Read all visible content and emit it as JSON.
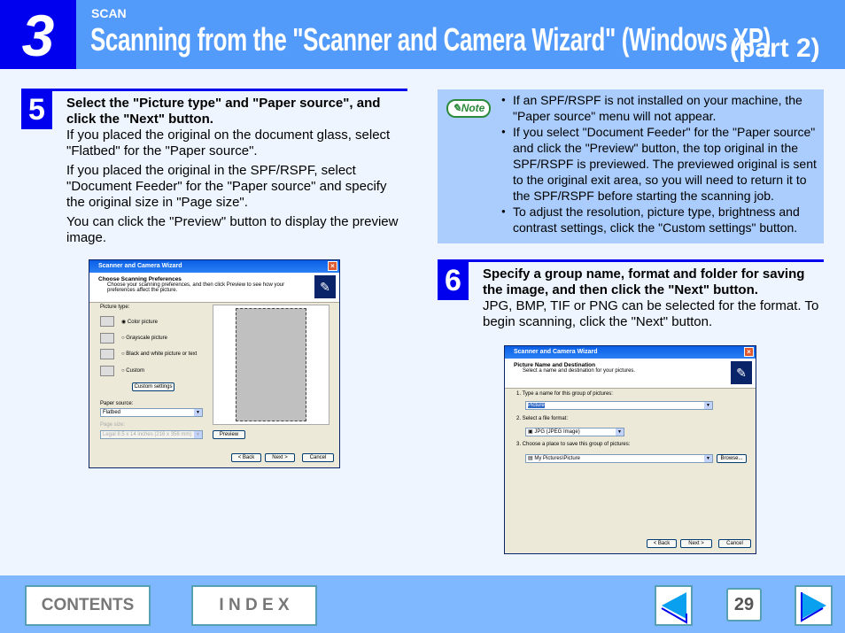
{
  "header": {
    "chapter": "3",
    "section": "SCAN",
    "title": "Scanning from the \"Scanner and Camera Wizard\" (Windows XP)",
    "part": "(part 2)",
    "colors": {
      "bar": "#529bfb",
      "chapter_box": "#0000ee"
    }
  },
  "step5": {
    "number": "5",
    "heading": "Select the \"Picture type\" and \"Paper source\", and click the \"Next\" button.",
    "paragraphs": [
      "If you placed the original on the document glass, select \"Flatbed\" for the \"Paper source\".",
      "If you placed the original in the SPF/RSPF, select \"Document Feeder\" for the \"Paper source\" and specify the original size in \"Page size\".",
      "You can click the \"Preview\" button to display the preview image."
    ],
    "dialog": {
      "title": "Scanner and Camera Wizard",
      "heading": "Choose Scanning Preferences",
      "subheading": "Choose your scanning preferences, and then click Preview to see how your preferences affect the picture.",
      "picture_type_label": "Picture type:",
      "options": [
        "Color picture",
        "Grayscale picture",
        "Black and white picture or text",
        "Custom"
      ],
      "selected_option": "Color picture",
      "custom_settings": "Custom settings",
      "paper_source_label": "Paper source:",
      "paper_source": "Flatbed",
      "page_size_label": "Page size:",
      "page_size": "Legal 8.5 x 14 inches (216 x 356 mm)",
      "preview": "Preview",
      "back": "< Back",
      "next": "Next >",
      "cancel": "Cancel"
    }
  },
  "note": {
    "label": "Note",
    "items": [
      "If an SPF/RSPF is not installed on your machine, the \"Paper source\" menu will not appear.",
      "If you select \"Document Feeder\" for the \"Paper source\" and click the \"Preview\" button, the top original in the SPF/RSPF is previewed. The previewed original is sent to the original exit area, so you will need to return it to the SPF/RSPF before starting the scanning job.",
      "To adjust the resolution, picture type, brightness and contrast settings, click the \"Custom settings\" button."
    ]
  },
  "step6": {
    "number": "6",
    "heading": "Specify a group name, format and folder for saving the image, and then click the \"Next\" button.",
    "paragraphs": [
      "JPG, BMP, TIF or PNG can be selected for the format. To begin scanning, click the \"Next\" button."
    ],
    "dialog": {
      "title": "Scanner and Camera Wizard",
      "heading": "Picture Name and Destination",
      "subheading": "Select a name and destination for your pictures.",
      "q1": "1.  Type a name for this group of pictures:",
      "name_value": "Picture",
      "q2": "2.  Select a file format:",
      "format_value": "JPG (JPEG Image)",
      "q3": "3.  Choose a place to save this group of pictures:",
      "folder_value": "My Pictures\\Picture",
      "browse": "Browse...",
      "back": "< Back",
      "next": "Next >",
      "cancel": "Cancel"
    }
  },
  "footer": {
    "contents": "CONTENTS",
    "index": "I N D E X",
    "page": "29"
  }
}
